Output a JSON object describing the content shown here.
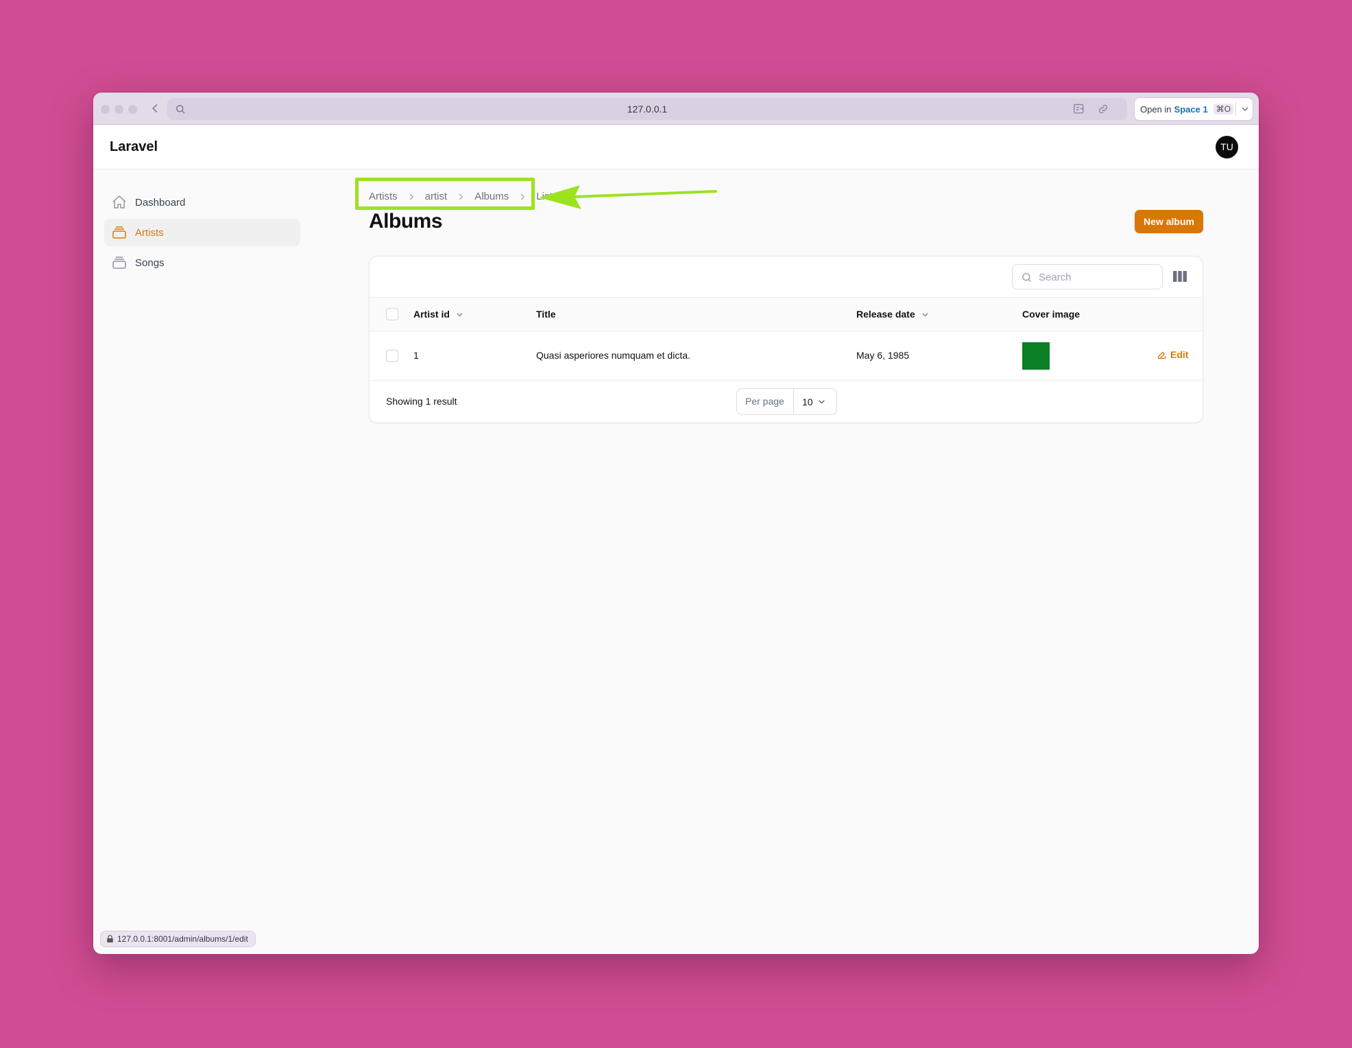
{
  "browser": {
    "url": "127.0.0.1",
    "open_in_prefix": "Open in",
    "open_in_space": "Space 1",
    "open_in_shortcut": "⌘O",
    "status_url": "127.0.0.1:8001/admin/albums/1/edit"
  },
  "header": {
    "brand": "Laravel",
    "avatar_initials": "TU"
  },
  "sidebar": {
    "items": [
      {
        "label": "Dashboard",
        "icon": "home-icon",
        "active": false
      },
      {
        "label": "Artists",
        "icon": "rectangle-stack-icon",
        "active": true
      },
      {
        "label": "Songs",
        "icon": "rectangle-stack-icon",
        "active": false
      }
    ]
  },
  "breadcrumb": [
    "Artists",
    "artist",
    "Albums",
    "List"
  ],
  "annotation": {
    "highlight_color": "#9de21f"
  },
  "page": {
    "title": "Albums",
    "new_button": "New album"
  },
  "table": {
    "search_placeholder": "Search",
    "columns": [
      "Artist id",
      "Title",
      "Release date",
      "Cover image"
    ],
    "rows": [
      {
        "artist_id": "1",
        "title": "Quasi asperiores numquam et dicta.",
        "release_date": "May 6, 1985",
        "cover_color": "#0a7f24",
        "action": "Edit"
      }
    ],
    "footer": {
      "showing": "Showing 1 result",
      "per_page_label": "Per page",
      "per_page_value": "10"
    }
  },
  "colors": {
    "accent": "#d97706",
    "background": "#d04d93"
  }
}
